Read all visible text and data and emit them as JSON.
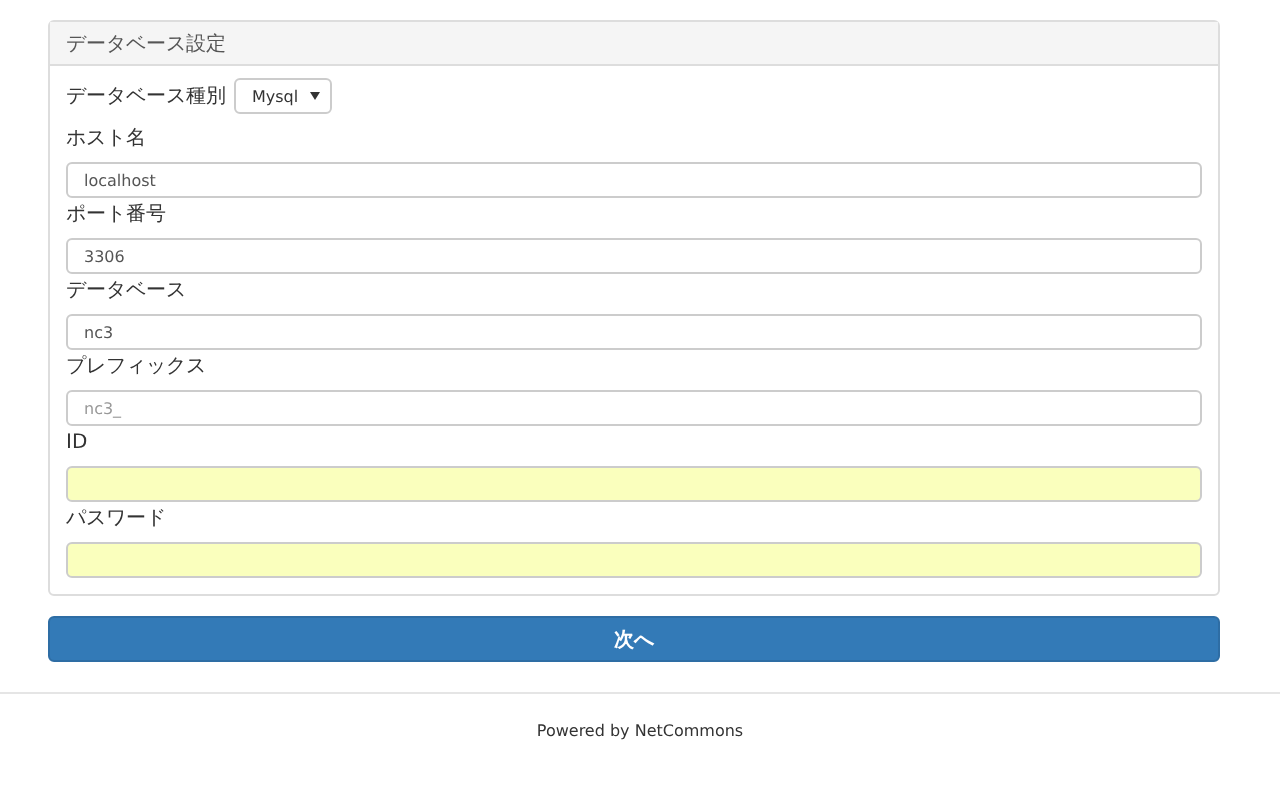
{
  "panel": {
    "title": "データベース設定",
    "db_type": {
      "label": "データベース種別",
      "value": "Mysql"
    },
    "fields": [
      {
        "label": "ホスト名",
        "value": "localhost",
        "autofilled": false
      },
      {
        "label": "ポート番号",
        "value": "3306",
        "autofilled": false
      },
      {
        "label": "データベース",
        "value": "nc3",
        "autofilled": false
      },
      {
        "label": "プレフィックス",
        "placeholder": "nc3_",
        "autofilled": false
      },
      {
        "label": "ID",
        "autofilled": true
      },
      {
        "label": "パスワード",
        "autofilled": true
      }
    ]
  },
  "next_button": "次へ",
  "footer": "Powered by NetCommons"
}
